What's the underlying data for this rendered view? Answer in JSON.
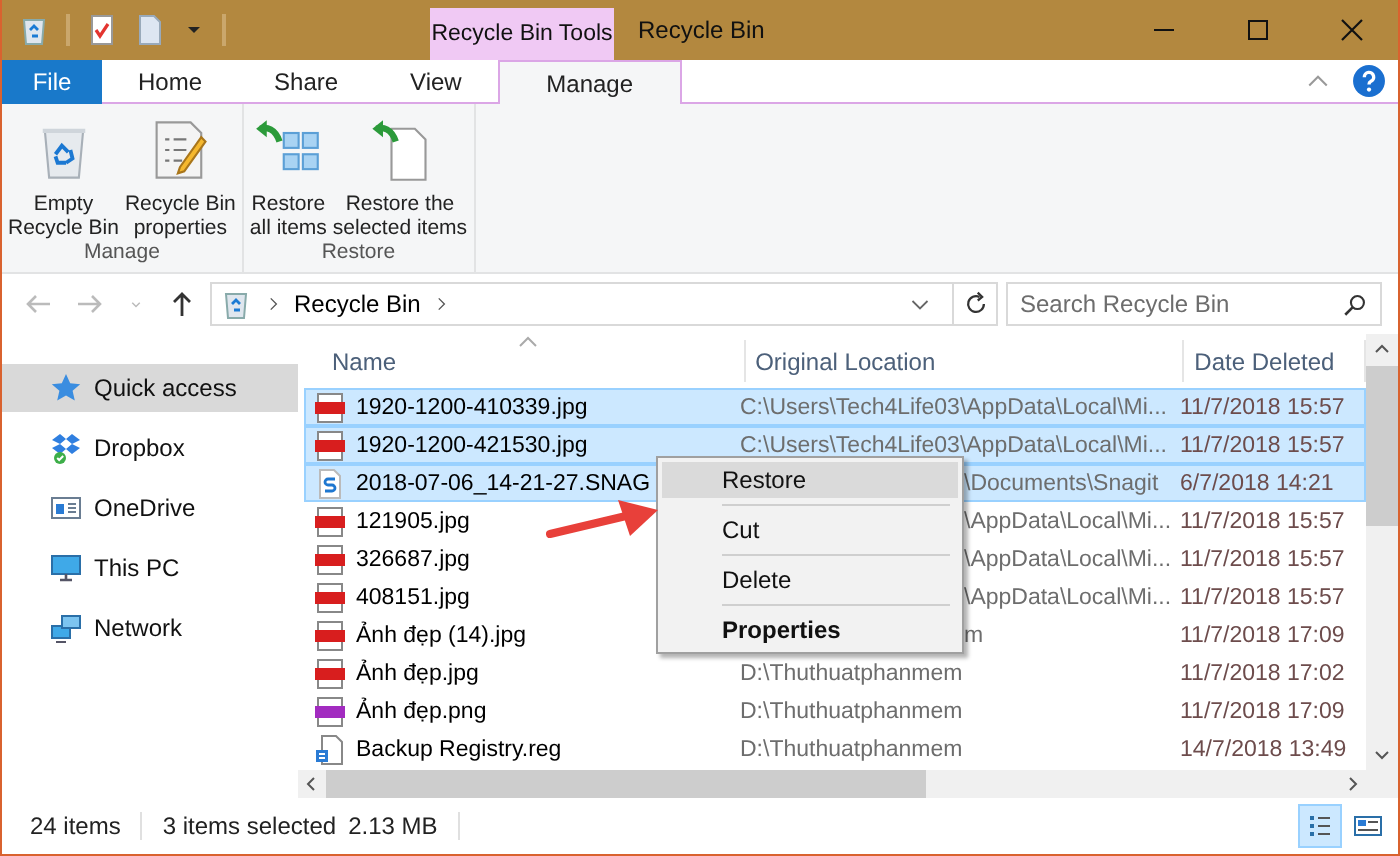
{
  "title_bar": {
    "context_group": "Recycle Bin Tools",
    "title": "Recycle Bin"
  },
  "ribbon_tabs": [
    {
      "label": "File",
      "kind": "file",
      "selected": false
    },
    {
      "label": "Home",
      "kind": "normal",
      "selected": false
    },
    {
      "label": "Share",
      "kind": "normal",
      "selected": false
    },
    {
      "label": "View",
      "kind": "normal",
      "selected": false
    },
    {
      "label": "Manage",
      "kind": "contextual",
      "selected": true
    }
  ],
  "ribbon_groups": [
    {
      "label": "Manage",
      "buttons": [
        {
          "lines": [
            "Empty",
            "Recycle Bin"
          ]
        },
        {
          "lines": [
            "Recycle Bin",
            "properties"
          ]
        }
      ]
    },
    {
      "label": "Restore",
      "buttons": [
        {
          "lines": [
            "Restore",
            "all items"
          ]
        },
        {
          "lines": [
            "Restore the",
            "selected items"
          ]
        }
      ]
    }
  ],
  "address": {
    "path": "Recycle Bin"
  },
  "search": {
    "placeholder": "Search Recycle Bin"
  },
  "sidebar": {
    "items": [
      {
        "label": "Quick access",
        "selected": true
      },
      {
        "label": "Dropbox",
        "selected": false
      },
      {
        "label": "OneDrive",
        "selected": false
      },
      {
        "label": "This PC",
        "selected": false
      },
      {
        "label": "Network",
        "selected": false
      }
    ]
  },
  "table": {
    "columns": [
      "Name",
      "Original Location",
      "Date Deleted"
    ],
    "rows": [
      {
        "name": "1920-1200-410339.jpg",
        "kind": "jpg",
        "location": "C:\\Users\\Tech4Life03\\AppData\\Local\\Mi...",
        "covered": false,
        "date": "11/7/2018 15:57",
        "selected": true
      },
      {
        "name": "1920-1200-421530.jpg",
        "kind": "jpg",
        "location": "C:\\Users\\Tech4Life03\\AppData\\Local\\Mi...",
        "covered": false,
        "date": "11/7/2018 15:57",
        "selected": true
      },
      {
        "name": "2018-07-06_14-21-27.SNAG",
        "kind": "snag",
        "location": "\\Documents\\Snagit",
        "covered": true,
        "date": "6/7/2018 14:21",
        "selected": true
      },
      {
        "name": "121905.jpg",
        "kind": "jpg",
        "location": "\\AppData\\Local\\Mi...",
        "covered": true,
        "date": "11/7/2018 15:57",
        "selected": false
      },
      {
        "name": "326687.jpg",
        "kind": "jpg",
        "location": "\\AppData\\Local\\Mi...",
        "covered": true,
        "date": "11/7/2018 15:57",
        "selected": false
      },
      {
        "name": "408151.jpg",
        "kind": "jpg",
        "location": "\\AppData\\Local\\Mi...",
        "covered": true,
        "date": "11/7/2018 15:57",
        "selected": false
      },
      {
        "name": "Ảnh đẹp (14).jpg",
        "kind": "jpg",
        "location": "m",
        "covered": true,
        "date": "11/7/2018 17:09",
        "selected": false
      },
      {
        "name": "Ảnh đẹp.jpg",
        "kind": "jpg",
        "location": "D:\\Thuthuatphanmem",
        "covered": false,
        "date": "11/7/2018 17:02",
        "selected": false
      },
      {
        "name": "Ảnh đẹp.png",
        "kind": "png",
        "location": "D:\\Thuthuatphanmem",
        "covered": false,
        "date": "11/7/2018 17:09",
        "selected": false
      },
      {
        "name": "Backup Registry.reg",
        "kind": "reg",
        "location": "D:\\Thuthuatphanmem",
        "covered": false,
        "date": "14/7/2018 13:49",
        "selected": false
      }
    ]
  },
  "context_menu": {
    "items": [
      {
        "label": "Restore",
        "kind": "normal",
        "highlighted": true
      },
      {
        "label": "Cut",
        "kind": "normal",
        "highlighted": false
      },
      {
        "label": "Delete",
        "kind": "normal",
        "highlighted": false
      },
      {
        "label": "Properties",
        "kind": "default",
        "highlighted": false
      }
    ]
  },
  "status_bar": {
    "item_count": "24 items",
    "selection": "3 items selected",
    "size": "2.13 MB",
    "views": [
      {
        "kind": "details",
        "selected": true
      },
      {
        "kind": "large_icons",
        "selected": false
      }
    ]
  }
}
